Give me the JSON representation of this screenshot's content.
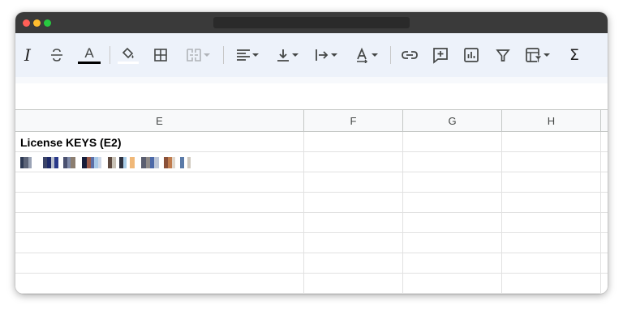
{
  "window": {
    "title_bar": ""
  },
  "toolbar": {
    "items": [
      {
        "name": "italic-icon",
        "glyph": "I"
      },
      {
        "name": "strikethrough-icon",
        "glyph": "S"
      },
      {
        "name": "text-color-icon",
        "glyph": "A"
      },
      {
        "name": "fill-color-icon"
      },
      {
        "name": "borders-icon"
      },
      {
        "name": "merge-cells-icon"
      },
      {
        "name": "horizontal-align-icon"
      },
      {
        "name": "vertical-align-icon"
      },
      {
        "name": "text-wrapping-icon"
      },
      {
        "name": "text-rotation-icon"
      },
      {
        "name": "insert-link-icon"
      },
      {
        "name": "insert-comment-icon"
      },
      {
        "name": "insert-chart-icon"
      },
      {
        "name": "filter-icon"
      },
      {
        "name": "filter-views-icon"
      },
      {
        "name": "functions-icon",
        "glyph": "Σ"
      }
    ]
  },
  "grid": {
    "columns": [
      "E",
      "F",
      "G",
      "H"
    ],
    "rows": [
      {
        "E": "License KEYS (E2)",
        "F": "",
        "G": "",
        "H": ""
      },
      {
        "E": "[redacted]",
        "F": "",
        "G": "",
        "H": ""
      },
      {
        "E": "",
        "F": "",
        "G": "",
        "H": ""
      },
      {
        "E": "",
        "F": "",
        "G": "",
        "H": ""
      },
      {
        "E": "",
        "F": "",
        "G": "",
        "H": ""
      },
      {
        "E": "",
        "F": "",
        "G": "",
        "H": ""
      },
      {
        "E": "",
        "F": "",
        "G": "",
        "H": ""
      },
      {
        "E": "",
        "F": "",
        "G": "",
        "H": ""
      }
    ]
  },
  "colors": {
    "toolbar_bg": "#edf2fa",
    "text_color_bar": "#000000"
  }
}
